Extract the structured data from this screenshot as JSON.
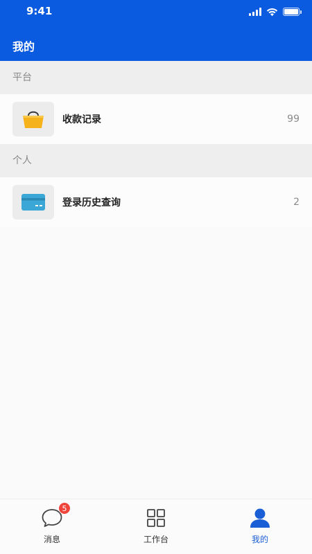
{
  "status_bar": {
    "time": "9:41"
  },
  "header": {
    "title": "我的"
  },
  "sections": {
    "platform": {
      "label": "平台"
    },
    "personal": {
      "label": "个人"
    }
  },
  "rows": {
    "payment_records": {
      "label": "收款记录",
      "count": "99",
      "icon": "shopping-bag-icon",
      "icon_color": "#f5b21b"
    },
    "login_history": {
      "label": "登录历史查询",
      "count": "2",
      "icon": "card-icon",
      "icon_color": "#3aa7d6"
    }
  },
  "tab_bar": {
    "messages": {
      "label": "消息",
      "badge": "5",
      "icon": "chat-bubble-icon"
    },
    "workbench": {
      "label": "工作台",
      "icon": "grid-icon"
    },
    "mine": {
      "label": "我的",
      "icon": "user-icon",
      "active": true
    }
  },
  "colors": {
    "brand": "#0a5be0",
    "active_tab": "#1a5fd6",
    "badge": "#f0453a"
  }
}
